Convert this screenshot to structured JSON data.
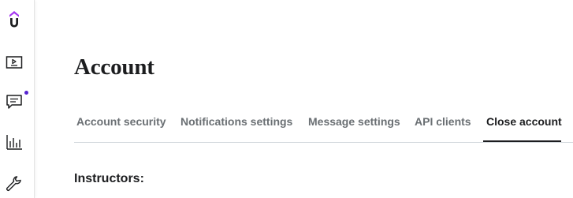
{
  "sidebar": {
    "items": [
      {
        "icon": "udemy-logo-icon"
      },
      {
        "icon": "video-course-icon"
      },
      {
        "icon": "chat-bubble-icon",
        "has_notification": true
      },
      {
        "icon": "bar-chart-icon"
      },
      {
        "icon": "wrench-icon"
      }
    ],
    "accent_color": "#5624d0"
  },
  "main": {
    "title": "Account",
    "tabs": [
      {
        "label": "Account security",
        "active": false
      },
      {
        "label": "Notifications settings",
        "active": false
      },
      {
        "label": "Message settings",
        "active": false
      },
      {
        "label": "API clients",
        "active": false
      },
      {
        "label": "Close account",
        "active": true
      }
    ],
    "section_heading": "Instructors:"
  }
}
